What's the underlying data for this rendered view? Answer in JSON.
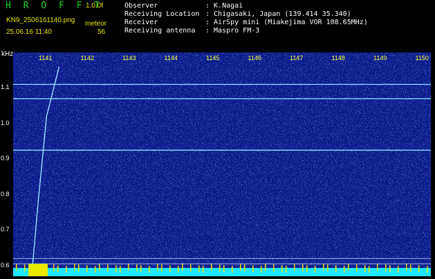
{
  "app": {
    "title": "H R O F F T",
    "version": "1.0.0f"
  },
  "file": {
    "name": "KN9_2506161140.png",
    "timestamp": "25.06.16 11:40"
  },
  "meteor": {
    "label": "meteor",
    "count": "56"
  },
  "info": {
    "observer_label": "Observer",
    "observer_value": ": K.Nagai",
    "location_label": "Receiving Location",
    "location_value": ": Chigasaki, Japan (139.414 35.340)",
    "receiver_label": "Receiver",
    "receiver_value": ": AirSpy mini (Miakejima VOR 108.65MHz)",
    "antenna_label": "Receiving antenna",
    "antenna_value": ": Maspro FM-3"
  },
  "chart_data": {
    "type": "heatmap",
    "ylabel": "kHz",
    "x_tick_labels": [
      "1141",
      "1142",
      "1143",
      "1144",
      "1145",
      "1146",
      "1147",
      "1148",
      "1149",
      "1150"
    ],
    "y_tick_labels": [
      "1.1",
      "1.0",
      "0.9",
      "0.8",
      "0.7",
      "0.6"
    ],
    "y_ticks": [
      1.1,
      1.0,
      0.9,
      0.8,
      0.7,
      0.6
    ],
    "ylim": [
      0.57,
      1.2
    ],
    "horizontal_lines_khz": [
      1.11,
      1.07,
      0.925,
      0.62,
      0.605
    ],
    "meteor_trace": [
      [
        1140.95,
        0.58
      ],
      [
        1141.1,
        0.78
      ],
      [
        1141.3,
        1.02
      ],
      [
        1141.6,
        1.16
      ]
    ],
    "colors": {
      "background": "#0a1a8a",
      "noise": "#4a6cff",
      "line": "#8fe8ff",
      "baseline": "#1ee8ff",
      "ticks": "#ffff33"
    }
  }
}
